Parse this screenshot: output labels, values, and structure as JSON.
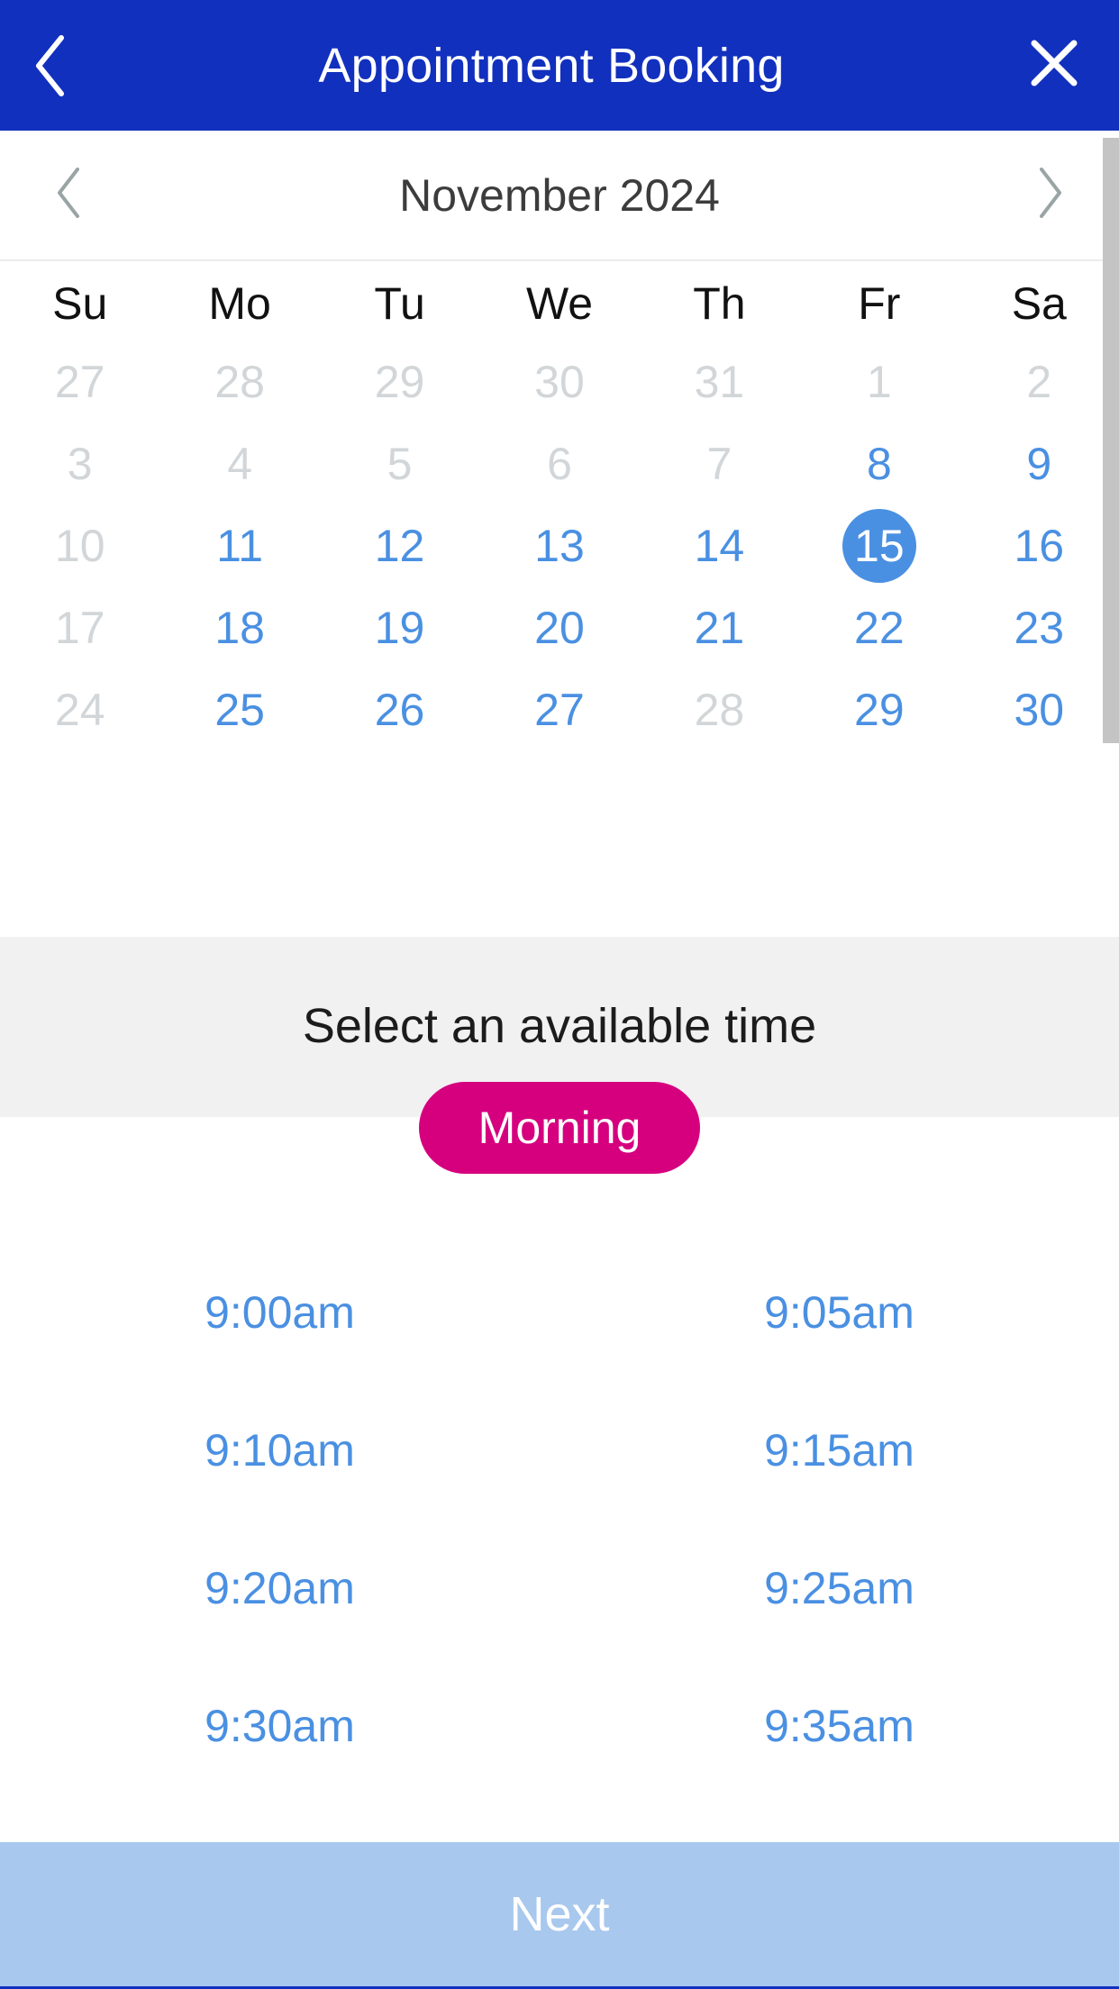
{
  "colors": {
    "header_bg": "#1230be",
    "accent_blue": "#4a90e2",
    "accent_magenta": "#d6007f",
    "next_bg": "#a8c8ee",
    "band_bg": "#f1f1f1",
    "disabled_gray": "#d2d6d8"
  },
  "header": {
    "title": "Appointment Booking",
    "back_icon": "chevron-left-icon",
    "close_icon": "close-x-icon"
  },
  "calendar": {
    "prev_icon": "chevron-left-icon",
    "next_icon": "chevron-right-icon",
    "month_label": "November 2024",
    "weekdays": [
      "Su",
      "Mo",
      "Tu",
      "We",
      "Th",
      "Fr",
      "Sa"
    ],
    "weeks": [
      [
        {
          "day": "27",
          "state": "disabled"
        },
        {
          "day": "28",
          "state": "disabled"
        },
        {
          "day": "29",
          "state": "disabled"
        },
        {
          "day": "30",
          "state": "disabled"
        },
        {
          "day": "31",
          "state": "disabled"
        },
        {
          "day": "1",
          "state": "disabled"
        },
        {
          "day": "2",
          "state": "disabled"
        }
      ],
      [
        {
          "day": "3",
          "state": "disabled"
        },
        {
          "day": "4",
          "state": "disabled"
        },
        {
          "day": "5",
          "state": "disabled"
        },
        {
          "day": "6",
          "state": "disabled"
        },
        {
          "day": "7",
          "state": "disabled"
        },
        {
          "day": "8",
          "state": "enabled"
        },
        {
          "day": "9",
          "state": "enabled"
        }
      ],
      [
        {
          "day": "10",
          "state": "disabled"
        },
        {
          "day": "11",
          "state": "enabled"
        },
        {
          "day": "12",
          "state": "enabled"
        },
        {
          "day": "13",
          "state": "enabled"
        },
        {
          "day": "14",
          "state": "enabled"
        },
        {
          "day": "15",
          "state": "selected"
        },
        {
          "day": "16",
          "state": "enabled"
        }
      ],
      [
        {
          "day": "17",
          "state": "disabled"
        },
        {
          "day": "18",
          "state": "enabled"
        },
        {
          "day": "19",
          "state": "enabled"
        },
        {
          "day": "20",
          "state": "enabled"
        },
        {
          "day": "21",
          "state": "enabled"
        },
        {
          "day": "22",
          "state": "enabled"
        },
        {
          "day": "23",
          "state": "enabled"
        }
      ],
      [
        {
          "day": "24",
          "state": "disabled"
        },
        {
          "day": "25",
          "state": "enabled"
        },
        {
          "day": "26",
          "state": "enabled"
        },
        {
          "day": "27",
          "state": "enabled"
        },
        {
          "day": "28",
          "state": "disabled"
        },
        {
          "day": "29",
          "state": "enabled"
        },
        {
          "day": "30",
          "state": "enabled"
        }
      ]
    ]
  },
  "time_section": {
    "heading": "Select an available time",
    "periods": [
      {
        "label": "Morning",
        "selected": true
      }
    ],
    "slots": [
      "9:00am",
      "9:05am",
      "9:10am",
      "9:15am",
      "9:20am",
      "9:25am",
      "9:30am",
      "9:35am"
    ]
  },
  "footer": {
    "next_label": "Next"
  }
}
